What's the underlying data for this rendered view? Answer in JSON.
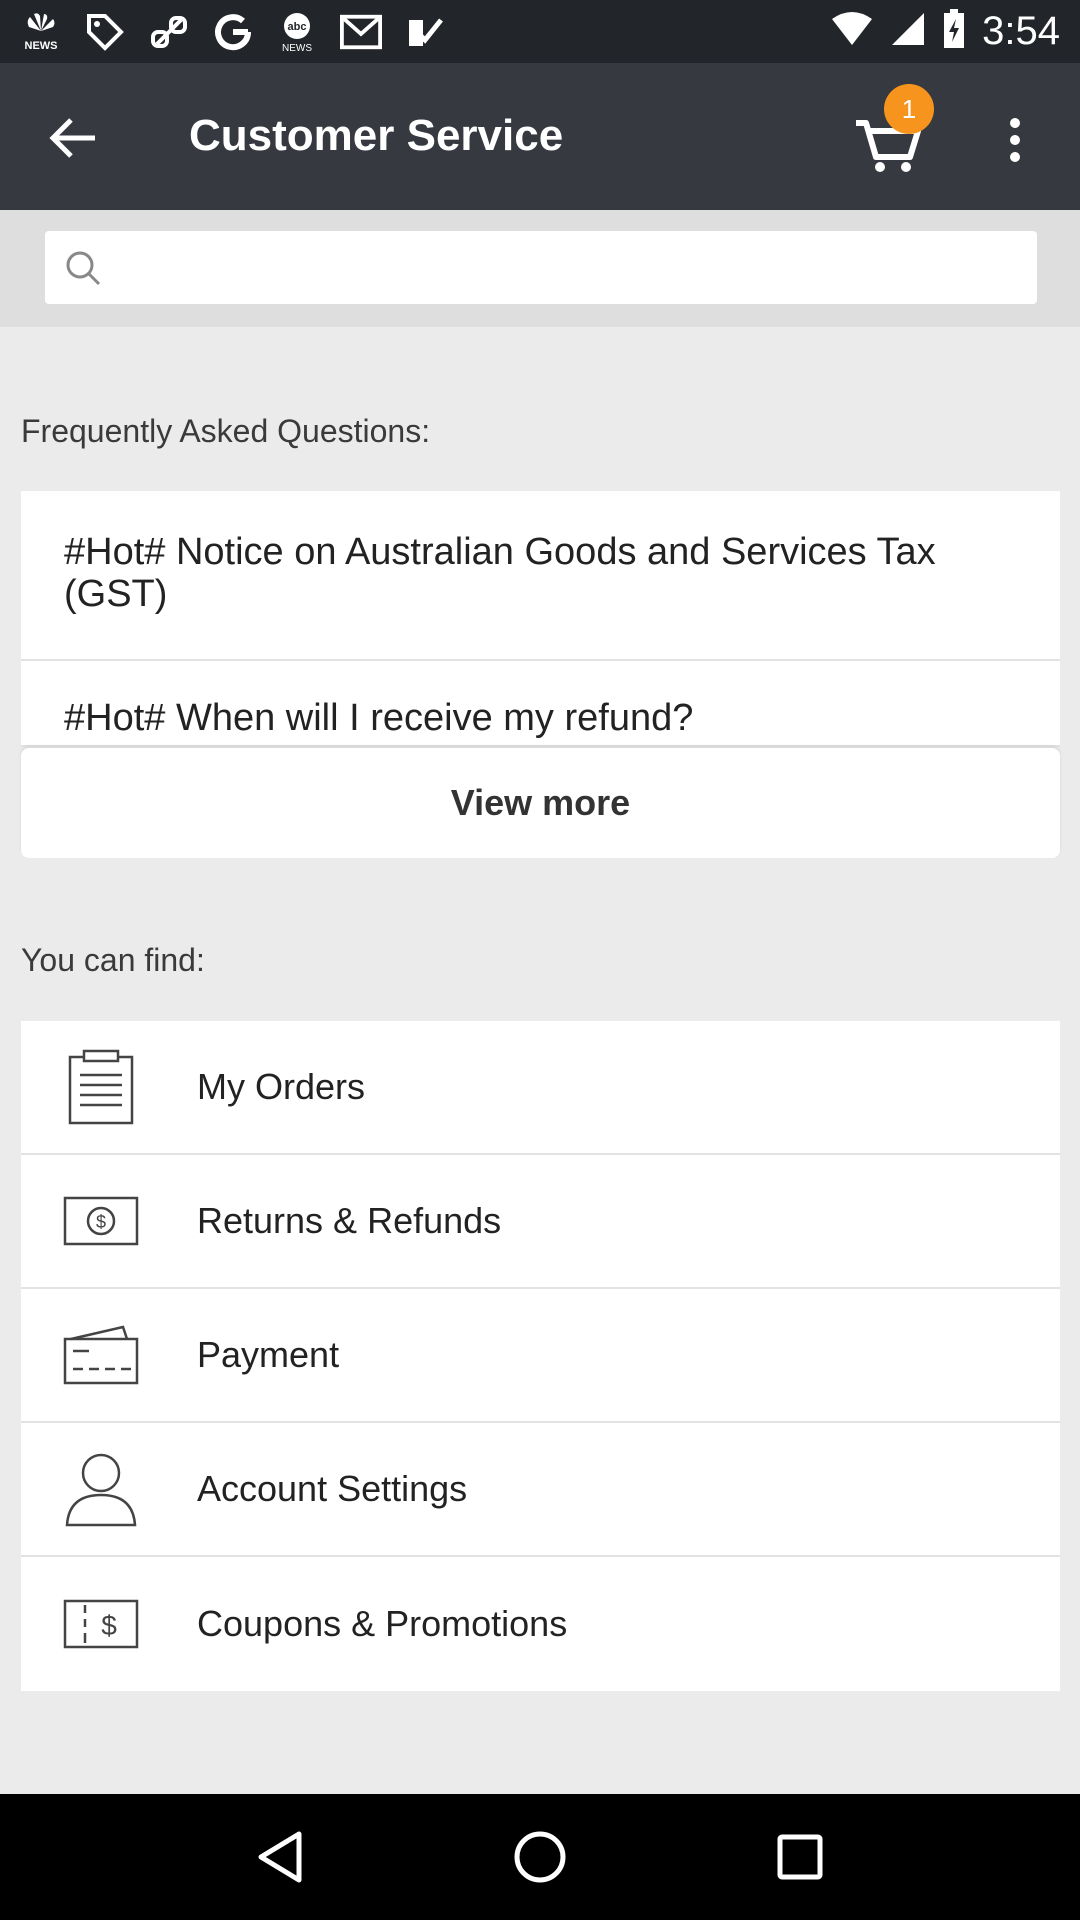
{
  "status_bar": {
    "time": "3:54",
    "notification_icons": [
      "nbc-news-icon",
      "tag-icon",
      "link-icon",
      "google-icon",
      "abc-news-icon",
      "gmail-icon",
      "check-icon"
    ]
  },
  "app_bar": {
    "title": "Customer Service",
    "cart_count": "1"
  },
  "search": {
    "placeholder": "",
    "value": ""
  },
  "faq": {
    "heading": "Frequently Asked Questions:",
    "items": [
      {
        "label": "#Hot# Notice on Australian Goods and Services Tax (GST)"
      },
      {
        "label": "#Hot# When will I receive my refund?"
      }
    ],
    "view_more_label": "View more"
  },
  "find": {
    "heading": "You can find:",
    "items": [
      {
        "label": "My Orders",
        "icon": "clipboard-icon"
      },
      {
        "label": "Returns & Refunds",
        "icon": "refund-money-icon"
      },
      {
        "label": "Payment",
        "icon": "card-icon"
      },
      {
        "label": "Account Settings",
        "icon": "person-icon"
      },
      {
        "label": "Coupons & Promotions",
        "icon": "coupon-icon"
      }
    ]
  },
  "colors": {
    "app_bar": "#363a40",
    "status_bar": "#222529",
    "badge": "#f7941d",
    "background": "#ebebeb"
  }
}
